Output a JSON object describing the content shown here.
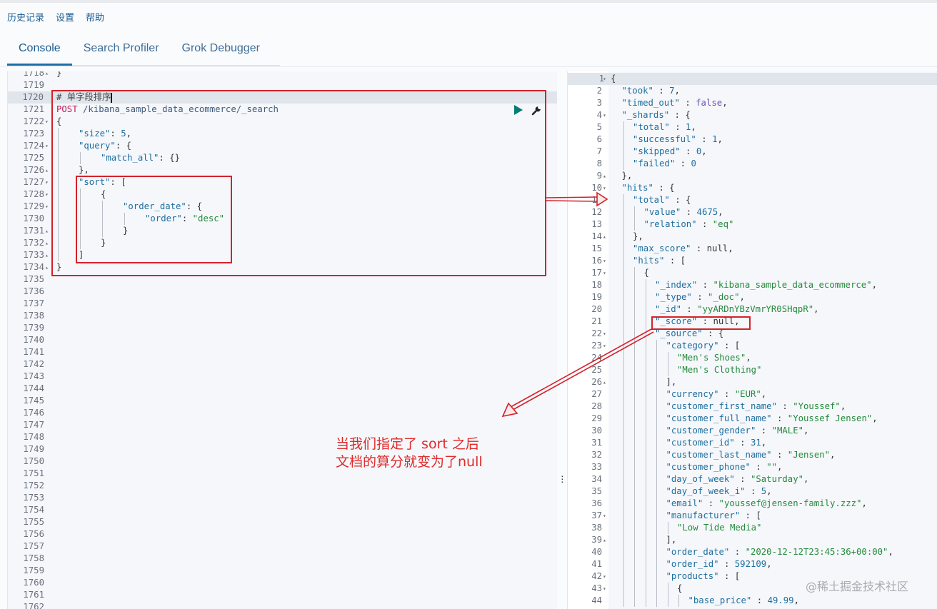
{
  "top_menu": [
    "历史记录",
    "设置",
    "帮助"
  ],
  "tabs": [
    {
      "label": "Console",
      "active": true
    },
    {
      "label": "Search Profiler",
      "active": false
    },
    {
      "label": "Grok Debugger",
      "active": false
    }
  ],
  "request_editor": {
    "first_line": 1718,
    "active_line": 1720,
    "lines": [
      {
        "n": "1718",
        "fold": "▴",
        "indent": 0,
        "tokens": [
          [
            "}",
            "punct"
          ]
        ]
      },
      {
        "n": "1719",
        "fold": "",
        "indent": 0,
        "tokens": []
      },
      {
        "n": "1720",
        "fold": "",
        "indent": 0,
        "tokens": [
          [
            "# 单字段排序",
            "comment"
          ]
        ],
        "cursor": true
      },
      {
        "n": "1721",
        "fold": "",
        "indent": 0,
        "tokens": [
          [
            "POST",
            "method"
          ],
          [
            " /kibana_sample_data_ecommerce/_search",
            "url"
          ]
        ]
      },
      {
        "n": "1722",
        "fold": "▾",
        "indent": 0,
        "tokens": [
          [
            "{",
            "punct"
          ]
        ]
      },
      {
        "n": "1723",
        "fold": "",
        "indent": 1,
        "tokens": [
          [
            "\"size\"",
            "key"
          ],
          [
            ": ",
            "punct"
          ],
          [
            "5",
            "num"
          ],
          [
            ",",
            "punct"
          ]
        ]
      },
      {
        "n": "1724",
        "fold": "▾",
        "indent": 1,
        "tokens": [
          [
            "\"query\"",
            "key"
          ],
          [
            ": {",
            "punct"
          ]
        ]
      },
      {
        "n": "1725",
        "fold": "",
        "indent": 2,
        "tokens": [
          [
            "\"match_all\"",
            "key"
          ],
          [
            ": {}",
            "punct"
          ]
        ]
      },
      {
        "n": "1726",
        "fold": "▴",
        "indent": 1,
        "tokens": [
          [
            "},",
            "punct"
          ]
        ]
      },
      {
        "n": "1727",
        "fold": "▾",
        "indent": 1,
        "tokens": [
          [
            "\"sort\"",
            "key"
          ],
          [
            ": [",
            "punct"
          ]
        ]
      },
      {
        "n": "1728",
        "fold": "▾",
        "indent": 2,
        "tokens": [
          [
            "{",
            "punct"
          ]
        ]
      },
      {
        "n": "1729",
        "fold": "▾",
        "indent": 3,
        "tokens": [
          [
            "\"order_date\"",
            "key"
          ],
          [
            ": {",
            "punct"
          ]
        ]
      },
      {
        "n": "1730",
        "fold": "",
        "indent": 4,
        "tokens": [
          [
            "\"order\"",
            "key"
          ],
          [
            ": ",
            "punct"
          ],
          [
            "\"desc\"",
            "str"
          ]
        ]
      },
      {
        "n": "1731",
        "fold": "▴",
        "indent": 3,
        "tokens": [
          [
            "}",
            "punct"
          ]
        ]
      },
      {
        "n": "1732",
        "fold": "▴",
        "indent": 2,
        "tokens": [
          [
            "}",
            "punct"
          ]
        ]
      },
      {
        "n": "1733",
        "fold": "▴",
        "indent": 1,
        "tokens": [
          [
            "]",
            "punct"
          ]
        ]
      },
      {
        "n": "1734",
        "fold": "▴",
        "indent": 0,
        "tokens": [
          [
            "}",
            "punct"
          ]
        ]
      },
      {
        "n": "1735"
      },
      {
        "n": "1736"
      },
      {
        "n": "1737"
      },
      {
        "n": "1738"
      },
      {
        "n": "1739"
      },
      {
        "n": "1740"
      },
      {
        "n": "1741"
      },
      {
        "n": "1742"
      },
      {
        "n": "1743"
      },
      {
        "n": "1744"
      },
      {
        "n": "1745"
      },
      {
        "n": "1746"
      },
      {
        "n": "1747"
      },
      {
        "n": "1748"
      },
      {
        "n": "1749"
      },
      {
        "n": "1750"
      },
      {
        "n": "1751"
      },
      {
        "n": "1752"
      },
      {
        "n": "1753"
      },
      {
        "n": "1754"
      },
      {
        "n": "1755"
      },
      {
        "n": "1756"
      },
      {
        "n": "1757"
      },
      {
        "n": "1758"
      },
      {
        "n": "1759"
      },
      {
        "n": "1760"
      },
      {
        "n": "1761"
      },
      {
        "n": "1762"
      }
    ]
  },
  "response_viewer": {
    "lines": [
      {
        "n": "1",
        "fold": "▾",
        "indent": 0,
        "tokens": [
          [
            "{",
            "punct"
          ]
        ]
      },
      {
        "n": "2",
        "fold": "",
        "indent": 1,
        "tokens": [
          [
            "\"took\"",
            "key"
          ],
          [
            " : ",
            "punct"
          ],
          [
            "7",
            "num"
          ],
          [
            ",",
            "punct"
          ]
        ]
      },
      {
        "n": "3",
        "fold": "",
        "indent": 1,
        "tokens": [
          [
            "\"timed_out\"",
            "key"
          ],
          [
            " : ",
            "punct"
          ],
          [
            "false",
            "kw"
          ],
          [
            ",",
            "punct"
          ]
        ]
      },
      {
        "n": "4",
        "fold": "▾",
        "indent": 1,
        "tokens": [
          [
            "\"_shards\"",
            "key"
          ],
          [
            " : {",
            "punct"
          ]
        ]
      },
      {
        "n": "5",
        "fold": "",
        "indent": 2,
        "tokens": [
          [
            "\"total\"",
            "key"
          ],
          [
            " : ",
            "punct"
          ],
          [
            "1",
            "num"
          ],
          [
            ",",
            "punct"
          ]
        ]
      },
      {
        "n": "6",
        "fold": "",
        "indent": 2,
        "tokens": [
          [
            "\"successful\"",
            "key"
          ],
          [
            " : ",
            "punct"
          ],
          [
            "1",
            "num"
          ],
          [
            ",",
            "punct"
          ]
        ]
      },
      {
        "n": "7",
        "fold": "",
        "indent": 2,
        "tokens": [
          [
            "\"skipped\"",
            "key"
          ],
          [
            " : ",
            "punct"
          ],
          [
            "0",
            "num"
          ],
          [
            ",",
            "punct"
          ]
        ]
      },
      {
        "n": "8",
        "fold": "",
        "indent": 2,
        "tokens": [
          [
            "\"failed\"",
            "key"
          ],
          [
            " : ",
            "punct"
          ],
          [
            "0",
            "num"
          ]
        ]
      },
      {
        "n": "9",
        "fold": "▴",
        "indent": 1,
        "tokens": [
          [
            "},",
            "punct"
          ]
        ]
      },
      {
        "n": "10",
        "fold": "▾",
        "indent": 1,
        "tokens": [
          [
            "\"hits\"",
            "key"
          ],
          [
            " : {",
            "punct"
          ]
        ]
      },
      {
        "n": "11",
        "fold": "▾",
        "indent": 2,
        "tokens": [
          [
            "\"total\"",
            "key"
          ],
          [
            " : {",
            "punct"
          ]
        ]
      },
      {
        "n": "12",
        "fold": "",
        "indent": 3,
        "tokens": [
          [
            "\"value\"",
            "key"
          ],
          [
            " : ",
            "punct"
          ],
          [
            "4675",
            "num"
          ],
          [
            ",",
            "punct"
          ]
        ]
      },
      {
        "n": "13",
        "fold": "",
        "indent": 3,
        "tokens": [
          [
            "\"relation\"",
            "key"
          ],
          [
            " : ",
            "punct"
          ],
          [
            "\"eq\"",
            "str"
          ]
        ]
      },
      {
        "n": "14",
        "fold": "▴",
        "indent": 2,
        "tokens": [
          [
            "},",
            "punct"
          ]
        ]
      },
      {
        "n": "15",
        "fold": "",
        "indent": 2,
        "tokens": [
          [
            "\"max_score\"",
            "key"
          ],
          [
            " : ",
            "punct"
          ],
          [
            "null",
            "punct"
          ],
          [
            ",",
            "punct"
          ]
        ]
      },
      {
        "n": "16",
        "fold": "▾",
        "indent": 2,
        "tokens": [
          [
            "\"hits\"",
            "key"
          ],
          [
            " : [",
            "punct"
          ]
        ]
      },
      {
        "n": "17",
        "fold": "▾",
        "indent": 3,
        "tokens": [
          [
            "{",
            "punct"
          ]
        ]
      },
      {
        "n": "18",
        "fold": "",
        "indent": 4,
        "tokens": [
          [
            "\"_index\"",
            "key"
          ],
          [
            " : ",
            "punct"
          ],
          [
            "\"kibana_sample_data_ecommerce\"",
            "str"
          ],
          [
            ",",
            "punct"
          ]
        ]
      },
      {
        "n": "19",
        "fold": "",
        "indent": 4,
        "tokens": [
          [
            "\"_type\"",
            "key"
          ],
          [
            " : ",
            "punct"
          ],
          [
            "\"_doc\"",
            "str"
          ],
          [
            ",",
            "punct"
          ]
        ]
      },
      {
        "n": "20",
        "fold": "",
        "indent": 4,
        "tokens": [
          [
            "\"_id\"",
            "key"
          ],
          [
            " : ",
            "punct"
          ],
          [
            "\"yyARDnYBzVmrYR0SHqpR\"",
            "str"
          ],
          [
            ",",
            "punct"
          ]
        ]
      },
      {
        "n": "21",
        "fold": "",
        "indent": 4,
        "tokens": [
          [
            "\"_score\"",
            "key"
          ],
          [
            " : ",
            "punct"
          ],
          [
            "null",
            "punct"
          ],
          [
            ",",
            "punct"
          ]
        ]
      },
      {
        "n": "22",
        "fold": "▾",
        "indent": 4,
        "tokens": [
          [
            "\"_source\"",
            "key"
          ],
          [
            " : {",
            "punct"
          ]
        ]
      },
      {
        "n": "23",
        "fold": "▾",
        "indent": 5,
        "tokens": [
          [
            "\"category\"",
            "key"
          ],
          [
            " : [",
            "punct"
          ]
        ]
      },
      {
        "n": "24",
        "fold": "",
        "indent": 6,
        "tokens": [
          [
            "\"Men's Shoes\"",
            "str"
          ],
          [
            ",",
            "punct"
          ]
        ]
      },
      {
        "n": "25",
        "fold": "",
        "indent": 6,
        "tokens": [
          [
            "\"Men's Clothing\"",
            "str"
          ]
        ]
      },
      {
        "n": "26",
        "fold": "▴",
        "indent": 5,
        "tokens": [
          [
            "],",
            "punct"
          ]
        ]
      },
      {
        "n": "27",
        "fold": "",
        "indent": 5,
        "tokens": [
          [
            "\"currency\"",
            "key"
          ],
          [
            " : ",
            "punct"
          ],
          [
            "\"EUR\"",
            "str"
          ],
          [
            ",",
            "punct"
          ]
        ]
      },
      {
        "n": "28",
        "fold": "",
        "indent": 5,
        "tokens": [
          [
            "\"customer_first_name\"",
            "key"
          ],
          [
            " : ",
            "punct"
          ],
          [
            "\"Youssef\"",
            "str"
          ],
          [
            ",",
            "punct"
          ]
        ]
      },
      {
        "n": "29",
        "fold": "",
        "indent": 5,
        "tokens": [
          [
            "\"customer_full_name\"",
            "key"
          ],
          [
            " : ",
            "punct"
          ],
          [
            "\"Youssef Jensen\"",
            "str"
          ],
          [
            ",",
            "punct"
          ]
        ]
      },
      {
        "n": "30",
        "fold": "",
        "indent": 5,
        "tokens": [
          [
            "\"customer_gender\"",
            "key"
          ],
          [
            " : ",
            "punct"
          ],
          [
            "\"MALE\"",
            "str"
          ],
          [
            ",",
            "punct"
          ]
        ]
      },
      {
        "n": "31",
        "fold": "",
        "indent": 5,
        "tokens": [
          [
            "\"customer_id\"",
            "key"
          ],
          [
            " : ",
            "punct"
          ],
          [
            "31",
            "num"
          ],
          [
            ",",
            "punct"
          ]
        ]
      },
      {
        "n": "32",
        "fold": "",
        "indent": 5,
        "tokens": [
          [
            "\"customer_last_name\"",
            "key"
          ],
          [
            " : ",
            "punct"
          ],
          [
            "\"Jensen\"",
            "str"
          ],
          [
            ",",
            "punct"
          ]
        ]
      },
      {
        "n": "33",
        "fold": "",
        "indent": 5,
        "tokens": [
          [
            "\"customer_phone\"",
            "key"
          ],
          [
            " : ",
            "punct"
          ],
          [
            "\"\"",
            "str"
          ],
          [
            ",",
            "punct"
          ]
        ]
      },
      {
        "n": "34",
        "fold": "",
        "indent": 5,
        "tokens": [
          [
            "\"day_of_week\"",
            "key"
          ],
          [
            " : ",
            "punct"
          ],
          [
            "\"Saturday\"",
            "str"
          ],
          [
            ",",
            "punct"
          ]
        ]
      },
      {
        "n": "35",
        "fold": "",
        "indent": 5,
        "tokens": [
          [
            "\"day_of_week_i\"",
            "key"
          ],
          [
            " : ",
            "punct"
          ],
          [
            "5",
            "num"
          ],
          [
            ",",
            "punct"
          ]
        ]
      },
      {
        "n": "36",
        "fold": "",
        "indent": 5,
        "tokens": [
          [
            "\"email\"",
            "key"
          ],
          [
            " : ",
            "punct"
          ],
          [
            "\"youssef@jensen-family.zzz\"",
            "str"
          ],
          [
            ",",
            "punct"
          ]
        ]
      },
      {
        "n": "37",
        "fold": "▾",
        "indent": 5,
        "tokens": [
          [
            "\"manufacturer\"",
            "key"
          ],
          [
            " : [",
            "punct"
          ]
        ]
      },
      {
        "n": "38",
        "fold": "",
        "indent": 6,
        "tokens": [
          [
            "\"Low Tide Media\"",
            "str"
          ]
        ]
      },
      {
        "n": "39",
        "fold": "▴",
        "indent": 5,
        "tokens": [
          [
            "],",
            "punct"
          ]
        ]
      },
      {
        "n": "40",
        "fold": "",
        "indent": 5,
        "tokens": [
          [
            "\"order_date\"",
            "key"
          ],
          [
            " : ",
            "punct"
          ],
          [
            "\"2020-12-12T23:45:36+00:00\"",
            "str"
          ],
          [
            ",",
            "punct"
          ]
        ]
      },
      {
        "n": "41",
        "fold": "",
        "indent": 5,
        "tokens": [
          [
            "\"order_id\"",
            "key"
          ],
          [
            " : ",
            "punct"
          ],
          [
            "592109",
            "num"
          ],
          [
            ",",
            "punct"
          ]
        ]
      },
      {
        "n": "42",
        "fold": "▾",
        "indent": 5,
        "tokens": [
          [
            "\"products\"",
            "key"
          ],
          [
            " : [",
            "punct"
          ]
        ]
      },
      {
        "n": "43",
        "fold": "▾",
        "indent": 6,
        "tokens": [
          [
            "{",
            "punct"
          ]
        ]
      },
      {
        "n": "44",
        "fold": "",
        "indent": 7,
        "tokens": [
          [
            "\"base_price\"",
            "key"
          ],
          [
            " : ",
            "punct"
          ],
          [
            "49.99",
            "num"
          ],
          [
            ",",
            "punct"
          ]
        ]
      }
    ]
  },
  "annotation": {
    "line1": "当我们指定了 sort 之后",
    "line2": "文档的算分就变为了null",
    "color": "#e02b2b"
  },
  "watermark": "@稀土掘金技术社区",
  "colors": {
    "accent": "#1b6fa8",
    "run": "#017d73",
    "annotation_red": "#d3222a"
  }
}
